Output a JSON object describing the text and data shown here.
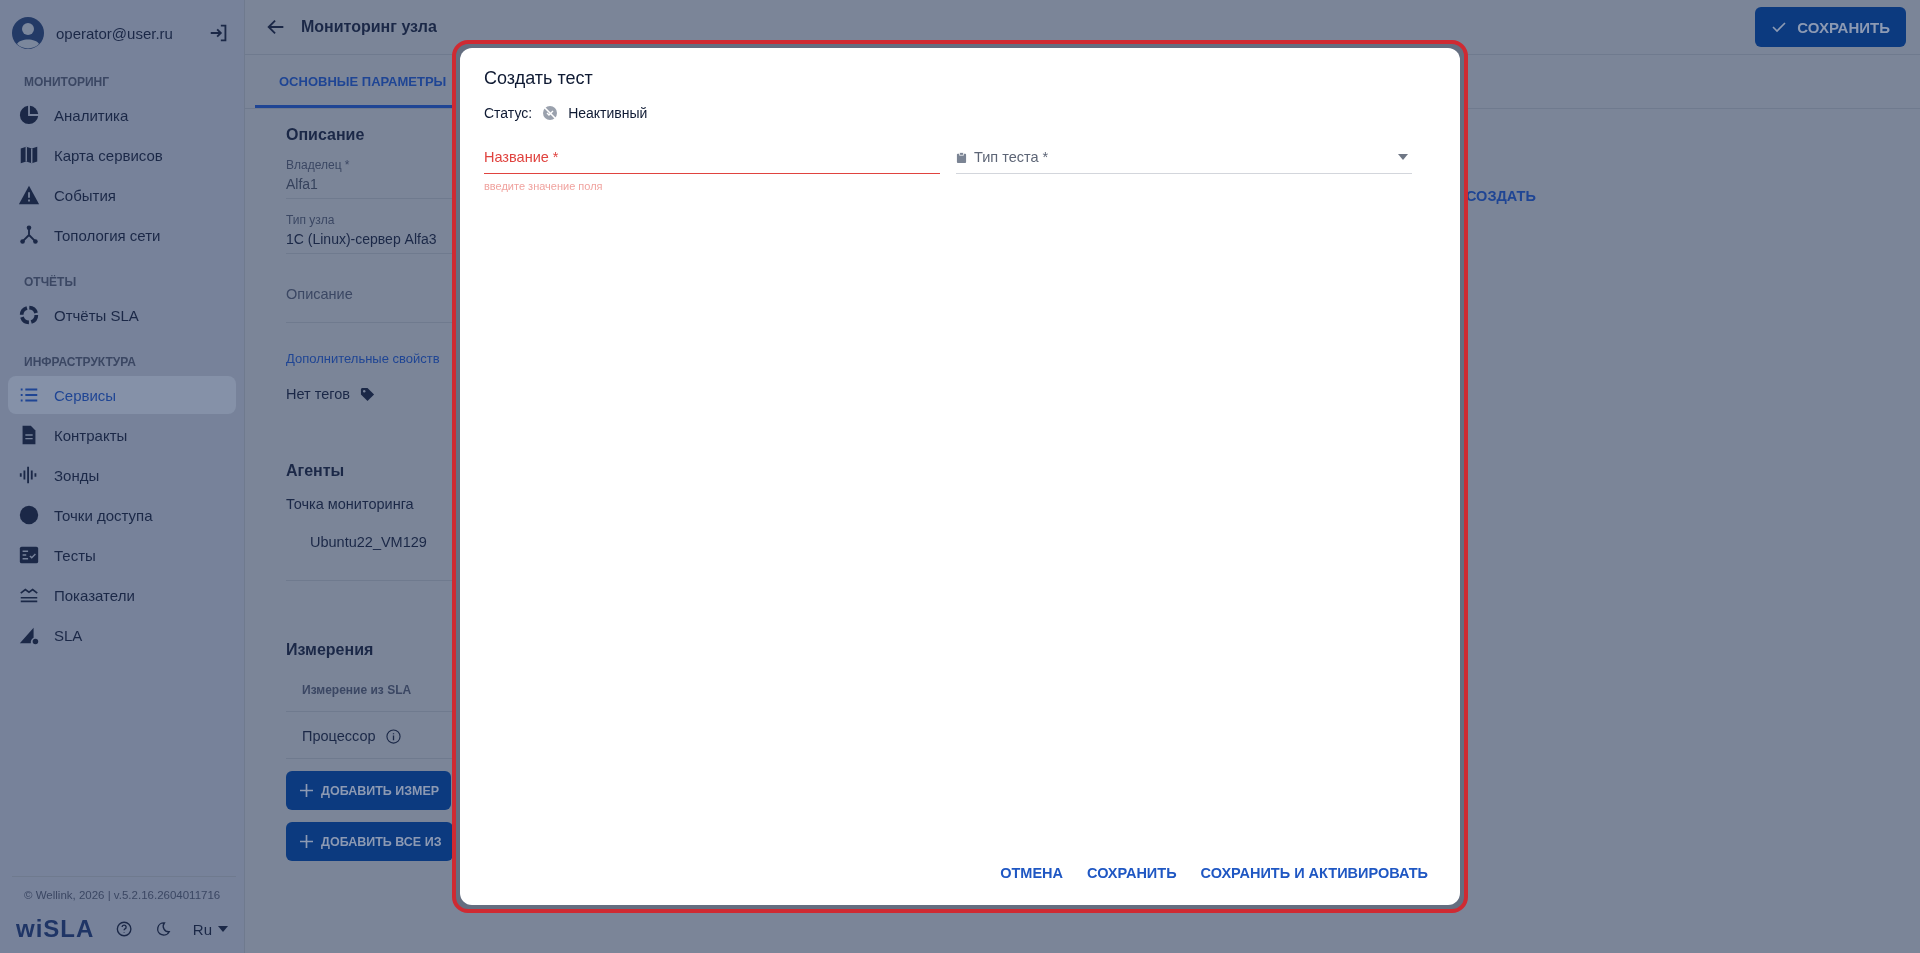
{
  "user": {
    "email": "operator@user.ru"
  },
  "sidebar": {
    "sections": [
      {
        "title": "МОНИТОРИНГ",
        "items": [
          {
            "label": "Аналитика",
            "selected": false
          },
          {
            "label": "Карта сервисов",
            "selected": false
          },
          {
            "label": "События",
            "selected": false
          },
          {
            "label": "Топология сети",
            "selected": false
          }
        ]
      },
      {
        "title": "ОТЧЁТЫ",
        "items": [
          {
            "label": "Отчёты SLA",
            "selected": false
          }
        ]
      },
      {
        "title": "ИНФРАСТРУКТУРА",
        "items": [
          {
            "label": "Сервисы",
            "selected": true
          },
          {
            "label": "Контракты",
            "selected": false
          },
          {
            "label": "Зонды",
            "selected": false
          },
          {
            "label": "Точки доступа",
            "selected": false
          },
          {
            "label": "Тесты",
            "selected": false
          },
          {
            "label": "Показатели",
            "selected": false
          },
          {
            "label": "SLA",
            "selected": false
          }
        ]
      }
    ]
  },
  "footer": {
    "copyright": "© Wellink, 2026 | v.5.2.16.2604011716",
    "logo": "wiSLA",
    "language": "Ru"
  },
  "header": {
    "title": "Мониторинг узла",
    "save_button": "СОХРАНИТЬ"
  },
  "tabs": [
    {
      "label": "ОСНОВНЫЕ ПАРАМЕТРЫ",
      "selected": true
    }
  ],
  "description": {
    "title": "Описание",
    "fields": [
      {
        "label": "Владелец *",
        "value": "Alfa1",
        "disabled": true
      },
      {
        "label": "Тип узла",
        "value": "1С (Linux)-сервер Alfa3",
        "disabled": false
      }
    ],
    "placeholder": "Описание",
    "extra_link": "Дополнительные свойств",
    "tags": "Нет тегов"
  },
  "agents": {
    "title": "Агенты",
    "label": "Точка мониторинга",
    "items": [
      "Ubuntu22_VM129"
    ]
  },
  "measurements": {
    "title": "Измерения",
    "column": "Измерение из SLA",
    "rows": [
      "Процессор"
    ],
    "buttons": [
      "ДОБАВИТЬ ИЗМЕР",
      "ДОБАВИТЬ ВСЕ ИЗ"
    ]
  },
  "right_action": "СОЗДАТЬ",
  "dialog": {
    "title": "Создать тест",
    "status_label": "Статус:",
    "status": "Неактивный",
    "active": false,
    "fields": [
      {
        "kind": "text",
        "label": "Название *",
        "error": "введите значение поля"
      },
      {
        "kind": "select",
        "label": "Тип теста *"
      }
    ],
    "actions": [
      "ОТМЕНА",
      "СОХРАНИТЬ",
      "СОХРАНИТЬ И АКТИВИРОВАТЬ"
    ]
  }
}
